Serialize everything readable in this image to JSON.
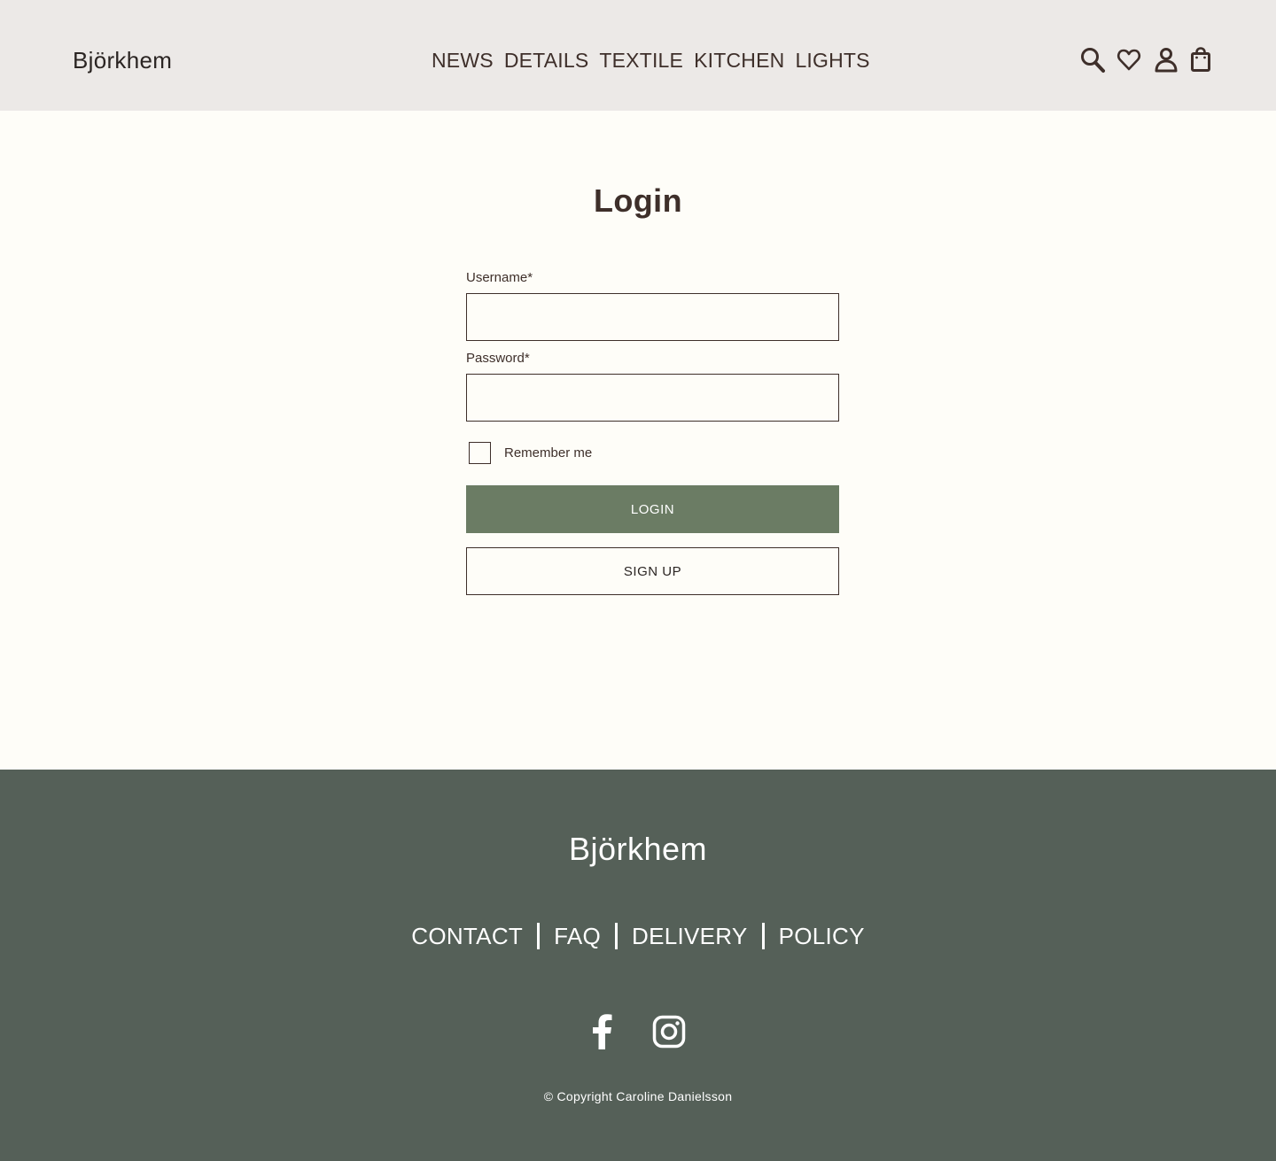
{
  "header": {
    "brand": "Björkhem",
    "nav": [
      {
        "label": "NEWS"
      },
      {
        "label": "DETAILS"
      },
      {
        "label": "TEXTILE"
      },
      {
        "label": "KITCHEN"
      },
      {
        "label": "LIGHTS"
      }
    ],
    "icons": [
      "search-icon",
      "heart-icon",
      "user-icon",
      "shopping-bag-icon"
    ]
  },
  "main": {
    "title": "Login",
    "form": {
      "username_label": "Username*",
      "username_value": "",
      "password_label": "Password*",
      "password_value": "",
      "remember_label": "Remember me",
      "remember_checked": false,
      "login_button": "LOGIN",
      "signup_button": "SIGN UP"
    }
  },
  "footer": {
    "brand": "Björkhem",
    "links": [
      {
        "label": "CONTACT"
      },
      {
        "label": "FAQ"
      },
      {
        "label": "DELIVERY"
      },
      {
        "label": "POLICY"
      }
    ],
    "social": [
      "facebook-icon",
      "instagram-icon"
    ],
    "copyright": "© Copyright Caroline Danielsson"
  },
  "colors": {
    "header_bg": "#ece9e7",
    "page_bg": "#fefdf8",
    "text": "#3e2f2a",
    "primary_button": "#6b7c64",
    "footer_bg": "#556058"
  }
}
